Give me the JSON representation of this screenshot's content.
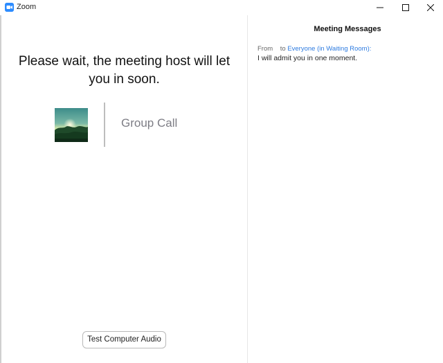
{
  "window": {
    "title": "Zoom",
    "controls": {
      "minimize_icon": "minimize-icon",
      "maximize_icon": "maximize-icon",
      "close_icon": "close-icon"
    }
  },
  "waiting_room": {
    "message": "Please wait, the meeting host will let you in soon.",
    "meeting_name": "Group Call",
    "test_audio_label": "Test Computer Audio"
  },
  "messages_panel": {
    "title": "Meeting Messages",
    "items": [
      {
        "from_label": "From",
        "to_prefix": "to",
        "recipient": "Everyone (in Waiting Room):",
        "text": "I will admit you in one moment."
      }
    ]
  },
  "colors": {
    "accent": "#2d8cff",
    "link": "#2d7be0",
    "muted_text": "#7d7d85"
  }
}
